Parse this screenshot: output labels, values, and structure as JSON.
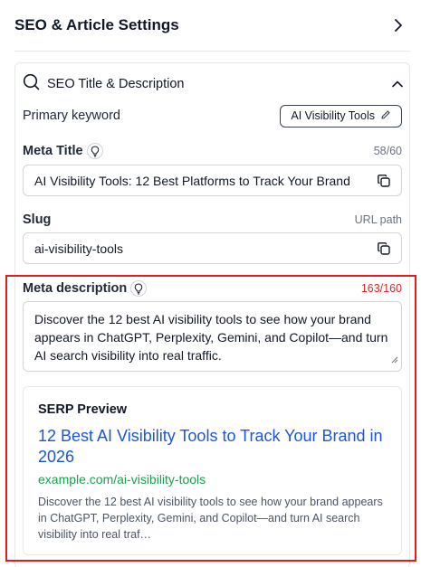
{
  "header": {
    "title": "SEO & Article Settings"
  },
  "section": {
    "title": "SEO Title & Description"
  },
  "primary_keyword": {
    "label": "Primary keyword",
    "value": "AI Visibility Tools"
  },
  "meta_title": {
    "label": "Meta Title",
    "counter": "58/60",
    "value": "AI Visibility Tools: 12 Best Platforms to Track Your Brand"
  },
  "slug": {
    "label": "Slug",
    "hint": "URL path",
    "value": "ai-visibility-tools"
  },
  "meta_description": {
    "label": "Meta description",
    "counter": "163/160",
    "value": "Discover the 12 best AI visibility tools to see how your brand appears in ChatGPT, Perplexity, Gemini, and Copilot—and turn AI search visibility into real traffic."
  },
  "serp": {
    "label": "SERP Preview",
    "title": "12 Best AI Visibility Tools to Track Your Brand in 2026",
    "url": "example.com/ai-visibility-tools",
    "description": "Discover the 12 best AI visibility tools to see how your brand appears in ChatGPT, Perplexity, Gemini, and Copilot—and turn AI search visibility into real traf…"
  },
  "colors": {
    "over_limit": "#dc2626",
    "serp_link": "#1a56db",
    "serp_url": "#16a34a",
    "highlight": "#e11d1d"
  }
}
